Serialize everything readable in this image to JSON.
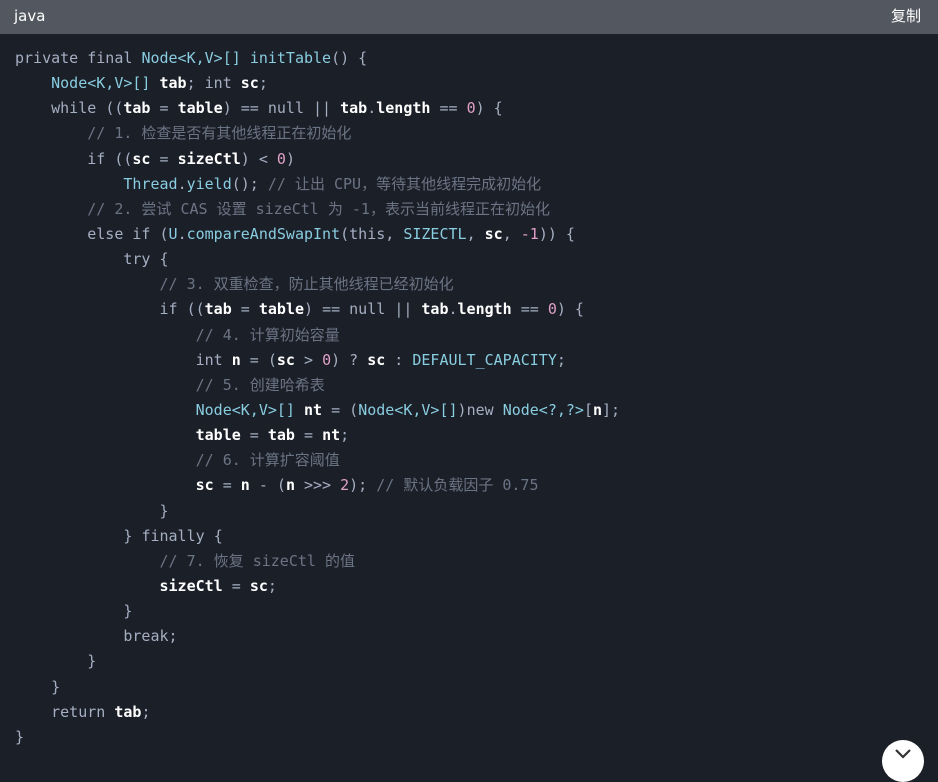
{
  "header": {
    "language": "java",
    "copy_label": "复制"
  },
  "code": {
    "lines": [
      [
        [
          "kw",
          "private final "
        ],
        [
          "ty",
          "Node<K,V>[] "
        ],
        [
          "fn",
          "initTable"
        ],
        [
          "pl",
          "() {"
        ]
      ],
      [
        [
          "pl",
          "    "
        ],
        [
          "ty",
          "Node<K,V>[] "
        ],
        [
          "id",
          "tab"
        ],
        [
          "pl",
          "; "
        ],
        [
          "kw",
          "int "
        ],
        [
          "id",
          "sc"
        ],
        [
          "pl",
          ";"
        ]
      ],
      [
        [
          "pl",
          "    "
        ],
        [
          "kw",
          "while "
        ],
        [
          "pl",
          "(("
        ],
        [
          "id",
          "tab"
        ],
        [
          "op",
          " = "
        ],
        [
          "id",
          "table"
        ],
        [
          "pl",
          ") "
        ],
        [
          "op",
          "== "
        ],
        [
          "kw",
          "null "
        ],
        [
          "op",
          "|| "
        ],
        [
          "id",
          "tab"
        ],
        [
          "pl",
          "."
        ],
        [
          "id",
          "length"
        ],
        [
          "op",
          " == "
        ],
        [
          "nm",
          "0"
        ],
        [
          "pl",
          ") {"
        ]
      ],
      [
        [
          "pl",
          "        "
        ],
        [
          "cm",
          "// 1. 检查是否有其他线程正在初始化"
        ]
      ],
      [
        [
          "pl",
          "        "
        ],
        [
          "kw",
          "if "
        ],
        [
          "pl",
          "(("
        ],
        [
          "id",
          "sc"
        ],
        [
          "op",
          " = "
        ],
        [
          "id",
          "sizeCtl"
        ],
        [
          "pl",
          ") "
        ],
        [
          "op",
          "< "
        ],
        [
          "nm",
          "0"
        ],
        [
          "pl",
          ")"
        ]
      ],
      [
        [
          "pl",
          "            "
        ],
        [
          "ty",
          "Thread"
        ],
        [
          "pl",
          "."
        ],
        [
          "fn",
          "yield"
        ],
        [
          "pl",
          "(); "
        ],
        [
          "cm",
          "// 让出 CPU，等待其他线程完成初始化"
        ]
      ],
      [
        [
          "pl",
          "        "
        ],
        [
          "cm",
          "// 2. 尝试 CAS 设置 sizeCtl 为 -1，表示当前线程正在初始化"
        ]
      ],
      [
        [
          "pl",
          "        "
        ],
        [
          "kw",
          "else if "
        ],
        [
          "pl",
          "("
        ],
        [
          "ty",
          "U"
        ],
        [
          "pl",
          "."
        ],
        [
          "fn",
          "compareAndSwapInt"
        ],
        [
          "pl",
          "("
        ],
        [
          "kw",
          "this"
        ],
        [
          "pl",
          ", "
        ],
        [
          "cn",
          "SIZECTL"
        ],
        [
          "pl",
          ", "
        ],
        [
          "id",
          "sc"
        ],
        [
          "pl",
          ", "
        ],
        [
          "nm",
          "-1"
        ],
        [
          "pl",
          ")) {"
        ]
      ],
      [
        [
          "pl",
          "            "
        ],
        [
          "kw",
          "try "
        ],
        [
          "pl",
          "{"
        ]
      ],
      [
        [
          "pl",
          "                "
        ],
        [
          "cm",
          "// 3. 双重检查，防止其他线程已经初始化"
        ]
      ],
      [
        [
          "pl",
          "                "
        ],
        [
          "kw",
          "if "
        ],
        [
          "pl",
          "(("
        ],
        [
          "id",
          "tab"
        ],
        [
          "op",
          " = "
        ],
        [
          "id",
          "table"
        ],
        [
          "pl",
          ") "
        ],
        [
          "op",
          "== "
        ],
        [
          "kw",
          "null "
        ],
        [
          "op",
          "|| "
        ],
        [
          "id",
          "tab"
        ],
        [
          "pl",
          "."
        ],
        [
          "id",
          "length"
        ],
        [
          "op",
          " == "
        ],
        [
          "nm",
          "0"
        ],
        [
          "pl",
          ") {"
        ]
      ],
      [
        [
          "pl",
          "                    "
        ],
        [
          "cm",
          "// 4. 计算初始容量"
        ]
      ],
      [
        [
          "pl",
          "                    "
        ],
        [
          "kw",
          "int "
        ],
        [
          "id",
          "n"
        ],
        [
          "op",
          " = "
        ],
        [
          "pl",
          "("
        ],
        [
          "id",
          "sc"
        ],
        [
          "op",
          " > "
        ],
        [
          "nm",
          "0"
        ],
        [
          "pl",
          ") "
        ],
        [
          "op",
          "? "
        ],
        [
          "id",
          "sc"
        ],
        [
          "op",
          " : "
        ],
        [
          "cn",
          "DEFAULT_CAPACITY"
        ],
        [
          "pl",
          ";"
        ]
      ],
      [
        [
          "pl",
          "                    "
        ],
        [
          "cm",
          "// 5. 创建哈希表"
        ]
      ],
      [
        [
          "pl",
          "                    "
        ],
        [
          "ty",
          "Node<K,V>[] "
        ],
        [
          "id",
          "nt"
        ],
        [
          "op",
          " = "
        ],
        [
          "pl",
          "("
        ],
        [
          "ty",
          "Node<K,V>[]"
        ],
        [
          "pl",
          ")"
        ],
        [
          "kw",
          "new "
        ],
        [
          "ty",
          "Node<?,?>"
        ],
        [
          "pl",
          "["
        ],
        [
          "id",
          "n"
        ],
        [
          "pl",
          "];"
        ]
      ],
      [
        [
          "pl",
          "                    "
        ],
        [
          "id",
          "table"
        ],
        [
          "op",
          " = "
        ],
        [
          "id",
          "tab"
        ],
        [
          "op",
          " = "
        ],
        [
          "id",
          "nt"
        ],
        [
          "pl",
          ";"
        ]
      ],
      [
        [
          "pl",
          "                    "
        ],
        [
          "cm",
          "// 6. 计算扩容阈值"
        ]
      ],
      [
        [
          "pl",
          "                    "
        ],
        [
          "id",
          "sc"
        ],
        [
          "op",
          " = "
        ],
        [
          "id",
          "n"
        ],
        [
          "op",
          " - "
        ],
        [
          "pl",
          "("
        ],
        [
          "id",
          "n"
        ],
        [
          "op",
          " >>> "
        ],
        [
          "nm",
          "2"
        ],
        [
          "pl",
          "); "
        ],
        [
          "cm",
          "// 默认负载因子 0.75"
        ]
      ],
      [
        [
          "pl",
          "                }"
        ]
      ],
      [
        [
          "pl",
          "            } "
        ],
        [
          "kw",
          "finally "
        ],
        [
          "pl",
          "{"
        ]
      ],
      [
        [
          "pl",
          "                "
        ],
        [
          "cm",
          "// 7. 恢复 sizeCtl 的值"
        ]
      ],
      [
        [
          "pl",
          "                "
        ],
        [
          "id",
          "sizeCtl"
        ],
        [
          "op",
          " = "
        ],
        [
          "id",
          "sc"
        ],
        [
          "pl",
          ";"
        ]
      ],
      [
        [
          "pl",
          "            }"
        ]
      ],
      [
        [
          "pl",
          "            "
        ],
        [
          "kw",
          "break"
        ],
        [
          "pl",
          ";"
        ]
      ],
      [
        [
          "pl",
          "        }"
        ]
      ],
      [
        [
          "pl",
          "    }"
        ]
      ],
      [
        [
          "pl",
          "    "
        ],
        [
          "kw",
          "return "
        ],
        [
          "id",
          "tab"
        ],
        [
          "pl",
          ";"
        ]
      ],
      [
        [
          "pl",
          "}"
        ]
      ]
    ]
  },
  "fab": {
    "icon": "chevron-down-icon"
  }
}
